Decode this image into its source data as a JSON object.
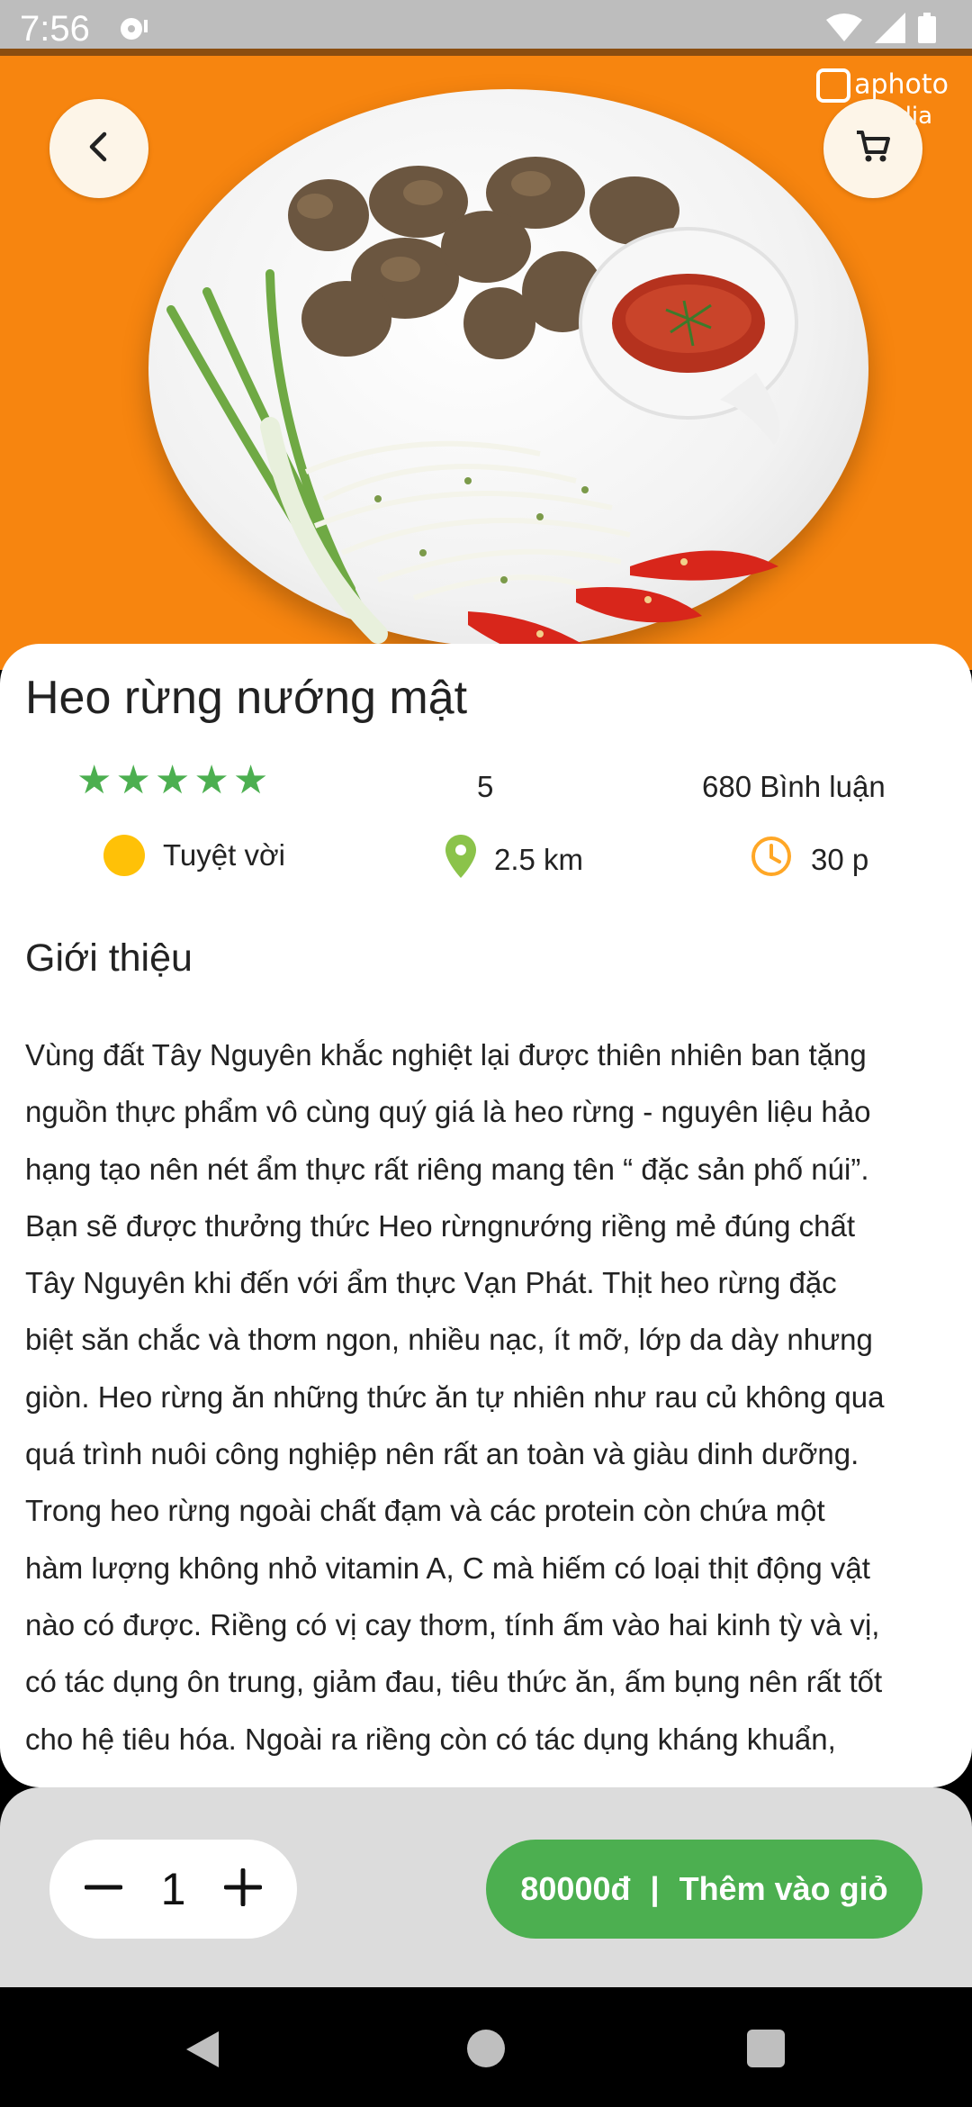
{
  "status_bar": {
    "time": "7:56"
  },
  "hero": {
    "watermark_line1": "aphoto",
    "watermark_line2": "media"
  },
  "dish": {
    "name": "Heo rừng nướng mật",
    "rating_stars": 5,
    "rating_value": "5",
    "comments": "680 Bình luận",
    "quality": "Tuyệt vời",
    "distance": "2.5 km",
    "time": "30 p"
  },
  "intro": {
    "heading": "Giới thiệu",
    "lines": [
      "Vùng đất Tây Nguyên khắc nghiệt lại được thiên nhiên ban tặng",
      "nguồn thực phẩm vô cùng quý giá là heo rừng - nguyên liệu hảo",
      "hạng tạo nên nét ẩm thực rất riêng mang tên “ đặc sản phố núi”.",
      "Bạn sẽ được thưởng thức Heo rừngnướng riềng mẻ đúng chất",
      "Tây Nguyên khi đến với ẩm thực Vạn Phát. Thịt heo rừng đặc",
      "biệt săn chắc và thơm ngon, nhiều nạc, ít mỡ, lớp da dày nhưng",
      "giòn. Heo rừng ăn những thức ăn tự nhiên như rau củ không qua",
      "quá trình nuôi công nghiệp nên rất an toàn và giàu dinh dưỡng.",
      "Trong heo rừng ngoài chất đạm và các protein còn chứa một",
      "hàm lượng không nhỏ vitamin A, C mà hiếm có loại thịt động vật",
      "nào có được. Riềng có vị cay thơm, tính ấm vào hai kinh tỳ và vị,",
      "có tác dụng ôn trung, giảm đau, tiêu thức ăn, ấm bụng nên rất tốt",
      "cho hệ tiêu hóa.  Ngoài ra riềng còn  có tác dụng kháng khuẩn,"
    ]
  },
  "cart_bar": {
    "quantity": "1",
    "price": "80000đ",
    "separator": "|",
    "add_label": "Thêm vào giỏ"
  },
  "colors": {
    "accent_green": "#4caf50",
    "hero_orange": "#f7850f",
    "quality_dot": "#ffc107",
    "location_icon": "#8bc34a",
    "clock_icon": "#ffa726"
  }
}
